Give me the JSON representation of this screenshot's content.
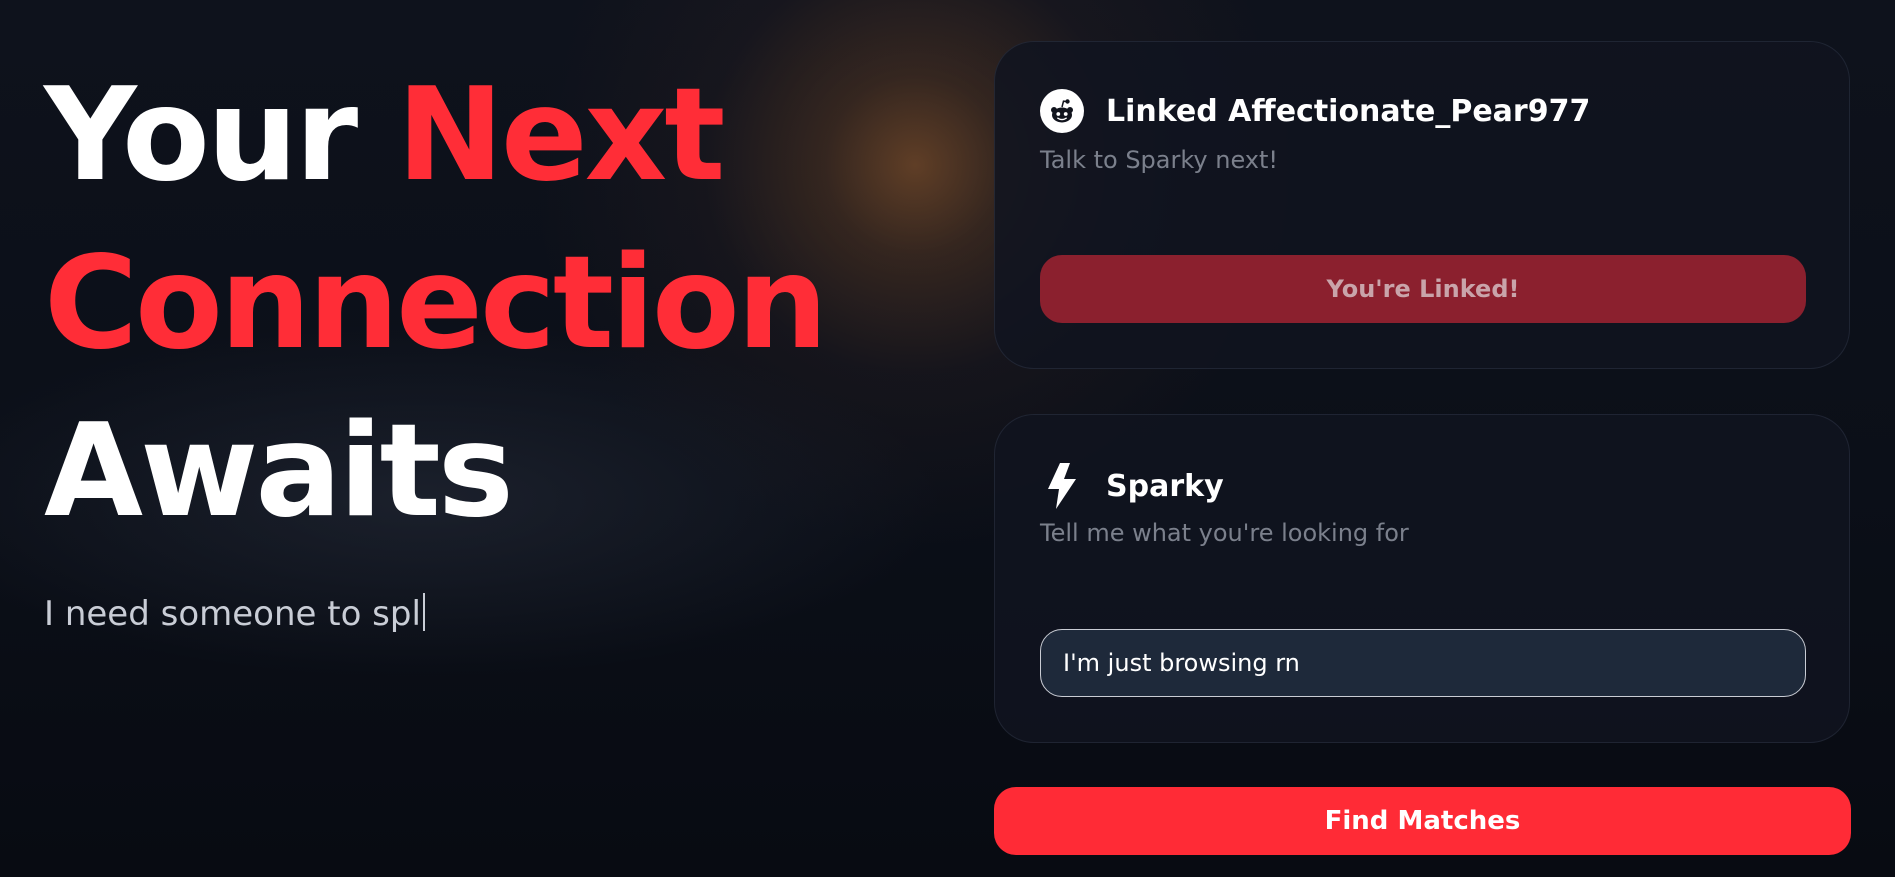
{
  "hero": {
    "line1_word1": "Your",
    "line1_word2": "Next",
    "line2": "Connection",
    "line3": "Awaits",
    "typing_text": "I need someone to spl"
  },
  "linked_card": {
    "icon": "reddit-icon",
    "title": "Linked Affectionate_Pear977",
    "subtitle": "Talk to Sparky next!",
    "button_label": "You're Linked!"
  },
  "sparky_card": {
    "icon": "lightning-bolt-icon",
    "title": "Sparky",
    "subtitle": "Tell me what you're looking for",
    "input_value": "I'm just browsing rn"
  },
  "find_button": {
    "label": "Find Matches"
  },
  "colors": {
    "accent_red": "#ff2d37",
    "linked_button_bg": "#8b202e",
    "card_bg": "#10141f",
    "input_bg": "#1e293a"
  }
}
